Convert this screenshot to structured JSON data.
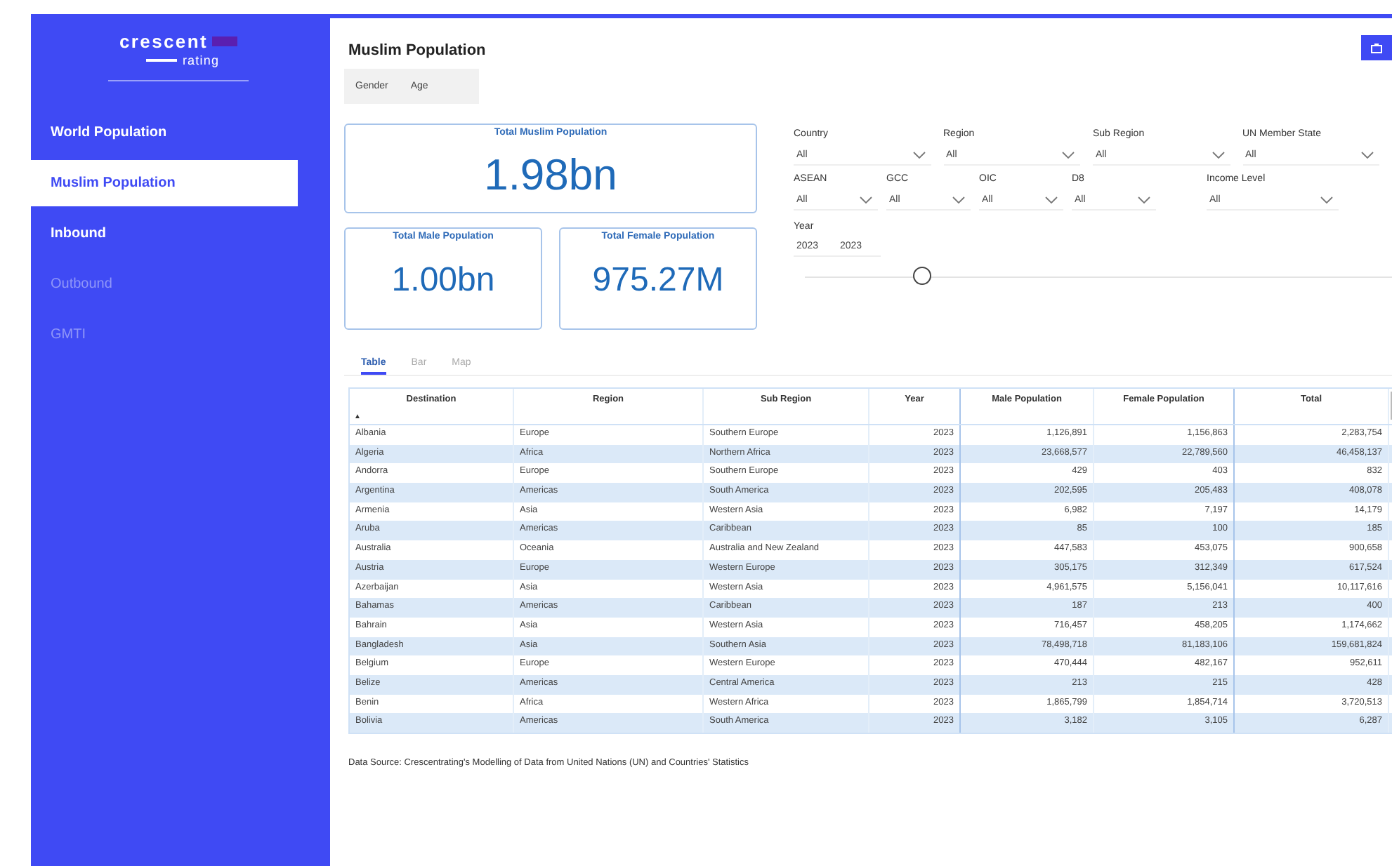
{
  "logo": {
    "name": "crescent",
    "badge": "rating"
  },
  "sidebar": {
    "items": [
      {
        "label": "World Population",
        "selected": false,
        "disabled": false
      },
      {
        "label": "Muslim Population",
        "selected": true,
        "disabled": false
      },
      {
        "label": "Inbound",
        "selected": false,
        "disabled": false
      },
      {
        "label": "Outbound",
        "selected": false,
        "disabled": true
      },
      {
        "label": "GMTI",
        "selected": false,
        "disabled": true
      }
    ]
  },
  "page": {
    "title": "Muslim Population"
  },
  "view_toggle": [
    {
      "label": "Gender",
      "selected": false
    },
    {
      "label": "Age",
      "selected": false
    }
  ],
  "kpis": {
    "main": {
      "label": "Total Muslim Population",
      "value": "1.98bn"
    },
    "sub": [
      {
        "label": "Total Male Population",
        "value": "1.00bn"
      },
      {
        "label": "Total Female Population",
        "value": "975.27M"
      }
    ]
  },
  "filters": {
    "row_1": [
      {
        "label": "Country",
        "value": "All"
      },
      {
        "label": "Region",
        "value": "All"
      },
      {
        "label": "Sub Region",
        "value": "All"
      },
      {
        "label": "UN Member State",
        "value": "All"
      }
    ],
    "row_2": [
      {
        "label": "ASEAN",
        "value": "All"
      },
      {
        "label": "GCC",
        "value": "All"
      },
      {
        "label": "OIC",
        "value": "All"
      },
      {
        "label": "D8",
        "value": "All"
      },
      {
        "label": "Income Level",
        "value": "All"
      }
    ],
    "year": {
      "label": "Year",
      "from": "2023",
      "to": "2023",
      "level": 0.2
    }
  },
  "view_tabs": [
    {
      "label": "Table",
      "selected": true
    },
    {
      "label": "Bar",
      "selected": false
    },
    {
      "label": "Map",
      "selected": false
    }
  ],
  "table": {
    "columns": [
      "Destination",
      "Region",
      "Sub Region",
      "Year",
      "Male Population",
      "Female Population",
      "Total"
    ],
    "sort_mark": "▲",
    "rows": [
      [
        "Albania",
        "Europe",
        "Southern Europe",
        "2023",
        "1,126,891",
        "1,156,863",
        "2,283,754"
      ],
      [
        "Algeria",
        "Africa",
        "Northern Africa",
        "2023",
        "23,668,577",
        "22,789,560",
        "46,458,137"
      ],
      [
        "Andorra",
        "Europe",
        "Southern Europe",
        "2023",
        "429",
        "403",
        "832"
      ],
      [
        "Argentina",
        "Americas",
        "South America",
        "2023",
        "202,595",
        "205,483",
        "408,078"
      ],
      [
        "Armenia",
        "Asia",
        "Western Asia",
        "2023",
        "6,982",
        "7,197",
        "14,179"
      ],
      [
        "Aruba",
        "Americas",
        "Caribbean",
        "2023",
        "85",
        "100",
        "185"
      ],
      [
        "Australia",
        "Oceania",
        "Australia and New Zealand",
        "2023",
        "447,583",
        "453,075",
        "900,658"
      ],
      [
        "Austria",
        "Europe",
        "Western Europe",
        "2023",
        "305,175",
        "312,349",
        "617,524"
      ],
      [
        "Azerbaijan",
        "Asia",
        "Western Asia",
        "2023",
        "4,961,575",
        "5,156,041",
        "10,117,616"
      ],
      [
        "Bahamas",
        "Americas",
        "Caribbean",
        "2023",
        "187",
        "213",
        "400"
      ],
      [
        "Bahrain",
        "Asia",
        "Western Asia",
        "2023",
        "716,457",
        "458,205",
        "1,174,662"
      ],
      [
        "Bangladesh",
        "Asia",
        "Southern Asia",
        "2023",
        "78,498,718",
        "81,183,106",
        "159,681,824"
      ],
      [
        "Belgium",
        "Europe",
        "Western Europe",
        "2023",
        "470,444",
        "482,167",
        "952,611"
      ],
      [
        "Belize",
        "Americas",
        "Central America",
        "2023",
        "213",
        "215",
        "428"
      ],
      [
        "Benin",
        "Africa",
        "Western Africa",
        "2023",
        "1,865,799",
        "1,854,714",
        "3,720,513"
      ],
      [
        "Bolivia",
        "Americas",
        "South America",
        "2023",
        "3,182",
        "3,105",
        "6,287"
      ]
    ]
  },
  "footer": "Data Source: Crescentrating's Modelling of Data from United Nations (UN) and Countries' Statistics"
}
